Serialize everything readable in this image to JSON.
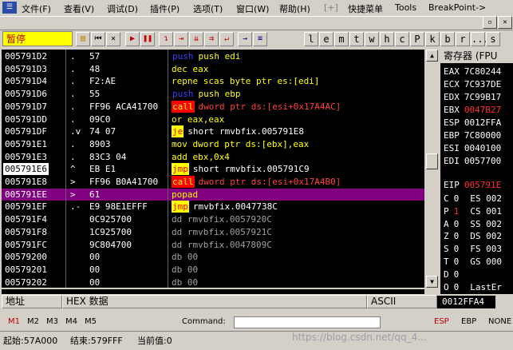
{
  "menu": [
    "文件(F)",
    "查看(V)",
    "调试(D)",
    "插件(P)",
    "选项(T)",
    "窗口(W)",
    "帮助(H)",
    "快捷菜单",
    "Tools",
    "BreakPoint->"
  ],
  "window_buttons": [
    "▫",
    "▫",
    "✕"
  ],
  "toolbar": {
    "status": "暂停",
    "letters": [
      "l",
      "e",
      "m",
      "t",
      "w",
      "h",
      "c",
      "P",
      "k",
      "b",
      "r",
      "...",
      "s"
    ]
  },
  "disasm": [
    {
      "addr": "005791D2",
      "mark": ".",
      "hex": "57",
      "op": "push edi",
      "hl": "push",
      "style": "blue"
    },
    {
      "addr": "005791D3",
      "mark": ".",
      "hex": "48",
      "op": "dec eax",
      "style": "yellow"
    },
    {
      "addr": "005791D4",
      "mark": ".",
      "hex": "F2:AE",
      "op": "repne scas byte ptr es:[edi]",
      "style": "yellow"
    },
    {
      "addr": "005791D6",
      "mark": ".",
      "hex": "55",
      "op": "push ebp",
      "hl": "push",
      "style": "blue"
    },
    {
      "addr": "005791D7",
      "mark": ".",
      "hex": "FF96 ACA41700",
      "op": "dword ptr ds:[esi+0x17A4AC]",
      "hl": "call",
      "style": "call"
    },
    {
      "addr": "005791DD",
      "mark": ".",
      "hex": "09C0",
      "op": "or eax,eax",
      "style": "yellow"
    },
    {
      "addr": "005791DF",
      "mark": ".v",
      "hex": "74 07",
      "op": "short rmvbfix.005791E8",
      "hl": "je",
      "style": "jump"
    },
    {
      "addr": "005791E1",
      "mark": ".",
      "hex": "8903",
      "op": "mov dword ptr ds:[ebx],eax",
      "style": "yellowmov"
    },
    {
      "addr": "005791E3",
      "mark": ".",
      "hex": "83C3 04",
      "op": "add ebx,0x4",
      "style": "yellowadd"
    },
    {
      "addr": "005791E6",
      "mark": "^",
      "hex": "EB E1",
      "op": "short rmvbfix.005791C9",
      "hl": "jmp",
      "style": "jump",
      "addr_sel": true
    },
    {
      "addr": "005791E8",
      "mark": ">",
      "hex": "FF96 B0A41700",
      "op": "dword ptr ds:[esi+0x17A4B0]",
      "hl": "call",
      "style": "call"
    },
    {
      "addr": "005791EE",
      "mark": ">",
      "hex": "61",
      "op": "popad",
      "style": "selected"
    },
    {
      "addr": "005791EF",
      "mark": ".-",
      "hex": "E9 98E1EFFF",
      "op": "rmvbfix.0047738C",
      "hl": "jmp",
      "style": "jump"
    },
    {
      "addr": "005791F4",
      "mark": "",
      "hex": "0C925700",
      "op": "dd rmvbfix.0057920C",
      "style": "gray"
    },
    {
      "addr": "005791F8",
      "mark": "",
      "hex": "1C925700",
      "op": "dd rmvbfix.0057921C",
      "style": "gray"
    },
    {
      "addr": "005791FC",
      "mark": "",
      "hex": "9C804700",
      "op": "dd rmvbfix.0047809C",
      "style": "gray"
    },
    {
      "addr": "00579200",
      "mark": "",
      "hex": "00",
      "op": "db 00",
      "style": "gray"
    },
    {
      "addr": "00579201",
      "mark": "",
      "hex": "00",
      "op": "db 00",
      "style": "gray"
    },
    {
      "addr": "00579202",
      "mark": "",
      "hex": "00",
      "op": "db 00",
      "style": "gray"
    }
  ],
  "registers": {
    "header": "寄存器 (FPU",
    "list": [
      {
        "name": "EAX",
        "value": "7C80244",
        "red": false
      },
      {
        "name": "ECX",
        "value": "7C937DE",
        "red": false
      },
      {
        "name": "EDX",
        "value": "7C99B17",
        "red": false
      },
      {
        "name": "EBX",
        "value": "0047B27",
        "red": true
      },
      {
        "name": "ESP",
        "value": "0012FFA",
        "red": false
      },
      {
        "name": "EBP",
        "value": "7C80000",
        "red": false
      },
      {
        "name": "ESI",
        "value": "0040100",
        "red": false
      },
      {
        "name": "EDI",
        "value": "0057700",
        "red": false
      },
      {
        "name": "EIP",
        "value": "005791E",
        "red": true
      }
    ],
    "flags": [
      {
        "f": "C",
        "v": "0",
        "seg": "ES 002"
      },
      {
        "f": "P",
        "v": "1",
        "seg": "CS 001"
      },
      {
        "f": "A",
        "v": "0",
        "seg": "SS 002"
      },
      {
        "f": "Z",
        "v": "0",
        "seg": "DS 002"
      },
      {
        "f": "S",
        "v": "0",
        "seg": "FS 003"
      },
      {
        "f": "T",
        "v": "0",
        "seg": "GS 000"
      },
      {
        "f": "D",
        "v": "0",
        "seg": ""
      },
      {
        "f": "O",
        "v": "0",
        "seg": "LastEr"
      }
    ]
  },
  "dump": {
    "addr_label": "地址",
    "hex_label": "HEX 数据",
    "ascii_label": "ASCII",
    "stack_addr": "0012FFA4"
  },
  "cmdbar": {
    "m": [
      "M1",
      "M2",
      "M3",
      "M4",
      "M5"
    ],
    "command_label": "Command:",
    "right": [
      "ESP",
      "EBP",
      "NONE"
    ]
  },
  "statusbar": {
    "start": "起始:57A000",
    "end": "结束:579FFF",
    "current": "当前值:0",
    "watermark": "https://blog.csdn.net/qq_4..."
  }
}
